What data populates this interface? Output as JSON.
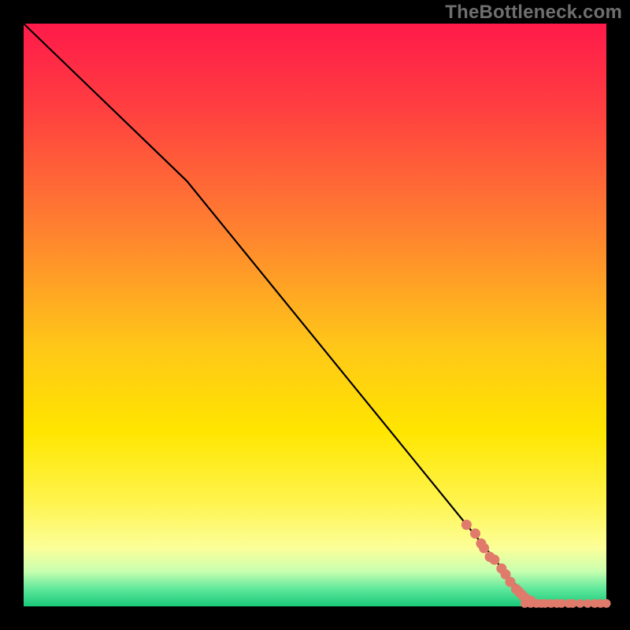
{
  "watermark": "TheBottleneck.com",
  "chart_data": {
    "type": "line",
    "title": "",
    "xlabel": "",
    "ylabel": "",
    "xlim": [
      0,
      100
    ],
    "ylim": [
      0,
      100
    ],
    "background_gradient": {
      "stops": [
        {
          "offset": 0.0,
          "color": "#ff1a4a"
        },
        {
          "offset": 0.15,
          "color": "#ff4040"
        },
        {
          "offset": 0.35,
          "color": "#ff8030"
        },
        {
          "offset": 0.55,
          "color": "#ffc619"
        },
        {
          "offset": 0.7,
          "color": "#ffe600"
        },
        {
          "offset": 0.82,
          "color": "#fff44d"
        },
        {
          "offset": 0.9,
          "color": "#fcff99"
        },
        {
          "offset": 0.94,
          "color": "#c8ffb0"
        },
        {
          "offset": 0.97,
          "color": "#5fe89b"
        },
        {
          "offset": 1.0,
          "color": "#19c97a"
        }
      ]
    },
    "series": [
      {
        "name": "curve",
        "type": "line",
        "color": "#000000",
        "x": [
          0.0,
          28.0,
          87.0,
          100.0
        ],
        "y": [
          100.0,
          73.0,
          0.5,
          0.5
        ]
      },
      {
        "name": "points-diagonal",
        "type": "scatter",
        "color": "#e07b6c",
        "x": [
          76.0,
          77.5,
          78.5,
          79.0,
          80.0,
          80.8,
          82.0,
          82.7,
          83.5,
          84.5,
          85.0,
          85.5,
          86.0,
          87.0
        ],
        "y": [
          14.0,
          12.5,
          10.8,
          10.0,
          8.5,
          8.0,
          6.5,
          5.5,
          4.2,
          3.0,
          2.5,
          2.0,
          1.5,
          1.0
        ]
      },
      {
        "name": "points-bottom",
        "type": "scatter",
        "color": "#e07b6c",
        "x": [
          86.0,
          87.0,
          88.0,
          88.8,
          89.5,
          90.5,
          91.5,
          92.3,
          93.5,
          94.2,
          95.5,
          96.8,
          98.0,
          99.0,
          100.0
        ],
        "y": [
          0.5,
          0.5,
          0.5,
          0.5,
          0.5,
          0.5,
          0.5,
          0.5,
          0.5,
          0.5,
          0.5,
          0.5,
          0.5,
          0.5,
          0.5
        ]
      }
    ]
  }
}
